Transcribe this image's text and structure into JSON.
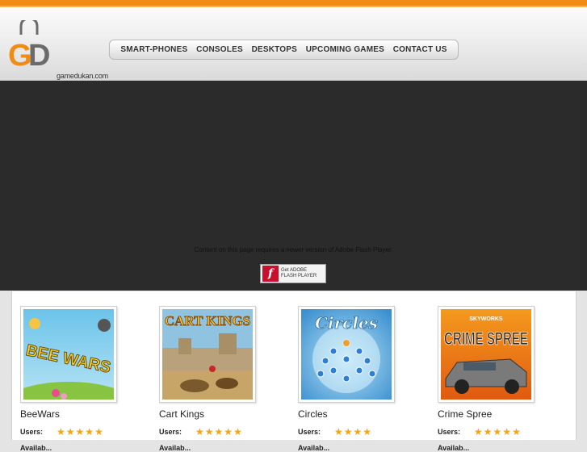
{
  "header": {
    "logo_letters": "GD",
    "site_name": "gamedukan.com",
    "nav": [
      "SMART-PHONES",
      "CONSOLES",
      "DESKTOPS",
      "UPCOMING GAMES",
      "CONTACT US"
    ]
  },
  "flash": {
    "message": "Content on this page requires a newer version of Adobe Flash Player.",
    "badge_line1": "Get ADOBE",
    "badge_line2": "FLASH PLAYER"
  },
  "games": [
    {
      "title": "BeeWars",
      "users_label": "Users:",
      "rating": 5,
      "thumb_text": "BEE WARS",
      "avail_label": "Availab..."
    },
    {
      "title": "Cart Kings",
      "users_label": "Users:",
      "rating": 5,
      "thumb_text": "CART KINGS",
      "avail_label": "Availab..."
    },
    {
      "title": "Circles",
      "users_label": "Users:",
      "rating": 4,
      "thumb_text": "Circles",
      "avail_label": "Availab..."
    },
    {
      "title": "Crime Spree",
      "users_label": "Users:",
      "rating": 5,
      "thumb_text": "CRIME SPREE",
      "thumb_subtext": "SKYWORKS",
      "avail_label": "Availab..."
    }
  ],
  "colors": {
    "accent_orange": "#f28b14",
    "star": "#f2a51a",
    "flash_bg": "#2b2b2b"
  }
}
